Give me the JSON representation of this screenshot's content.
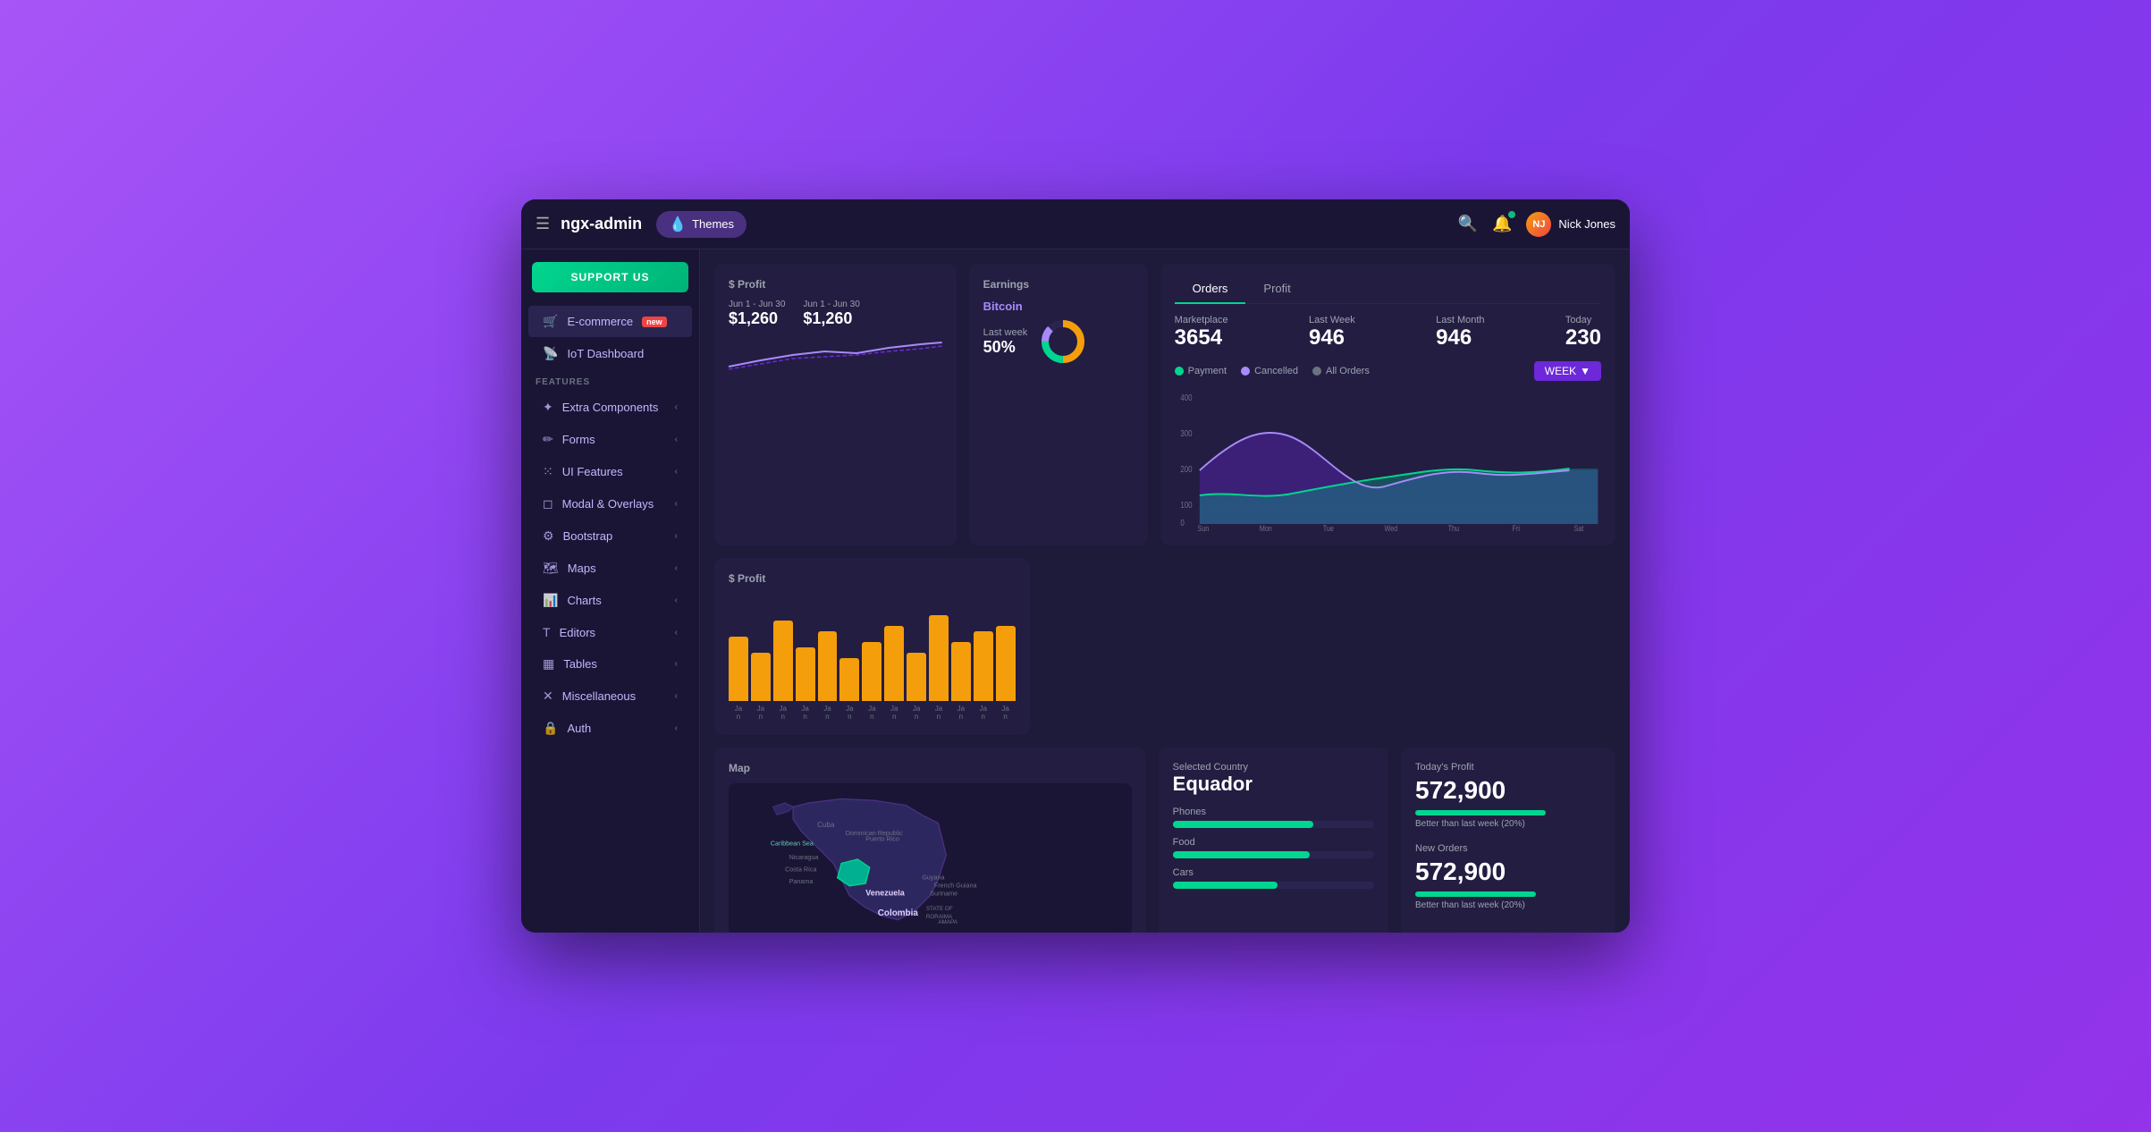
{
  "header": {
    "menu_icon": "☰",
    "logo": "ngx-admin",
    "themes_label": "Themes",
    "search_icon": "🔍",
    "user_name": "Nick Jones"
  },
  "sidebar": {
    "support_label": "SUPPORT US",
    "nav_items": [
      {
        "label": "E-commerce",
        "badge": "new",
        "icon": "🛒"
      },
      {
        "label": "IoT Dashboard",
        "icon": "📡"
      }
    ],
    "features_label": "FEATURES",
    "feature_items": [
      {
        "label": "Extra Components",
        "icon": "⭐"
      },
      {
        "label": "Forms",
        "icon": "✏️"
      },
      {
        "label": "UI Features",
        "icon": "⚙️"
      },
      {
        "label": "Modal & Overlays",
        "icon": "◻️"
      },
      {
        "label": "Bootstrap",
        "icon": "⚙️"
      },
      {
        "label": "Maps",
        "icon": "🗺️"
      },
      {
        "label": "Charts",
        "icon": "📊"
      },
      {
        "label": "Editors",
        "icon": "T"
      },
      {
        "label": "Tables",
        "icon": "▦"
      },
      {
        "label": "Miscellaneous",
        "icon": "✕"
      },
      {
        "label": "Auth",
        "icon": "🔒"
      }
    ]
  },
  "profit_card": {
    "title": "$ Profit",
    "date1": "Jun 1 - Jun 30",
    "date2": "Jun 1 - Jun 30",
    "value1": "$1,260",
    "value2": "$1,260"
  },
  "earnings_card": {
    "title": "Earnings",
    "coin": "Bitcoin",
    "week_label": "Last week",
    "week_value": "50%",
    "donut_percent": 50
  },
  "orders_card": {
    "tabs": [
      "Orders",
      "Profit"
    ],
    "active_tab": "Orders",
    "stats": [
      {
        "label": "Marketplace",
        "value": "3654"
      },
      {
        "label": "Last Week",
        "value": "946"
      },
      {
        "label": "Last Month",
        "value": "946"
      },
      {
        "label": "Today",
        "value": "230"
      }
    ],
    "legend": [
      {
        "label": "Payment",
        "color": "#00d68f"
      },
      {
        "label": "Cancelled",
        "color": "#a78bfa"
      },
      {
        "label": "All Orders",
        "color": "#6b7280"
      }
    ],
    "week_btn": "WEEK",
    "chart_yaxis": [
      "400",
      "300",
      "200",
      "100",
      "0"
    ],
    "chart_xaxis": [
      "Sun",
      "Mon",
      "Tue",
      "Wed",
      "Thu",
      "Fri",
      "Sat"
    ]
  },
  "profit_bar_card": {
    "title": "$ Profit",
    "bars": [
      60,
      45,
      75,
      50,
      65,
      40,
      55,
      70,
      45,
      80,
      55,
      65,
      70
    ],
    "bar_labels": [
      "Ja\nn",
      "Ja\nn",
      "Ja\nn",
      "Ja\nn",
      "Ja\nn",
      "Ja\nn",
      "Ja\nn",
      "Ja\nn",
      "Ja\nn",
      "Ja\nn",
      "Ja\nn",
      "Ja\nn",
      "Ja\nn"
    ]
  },
  "map_card": {
    "title": "Map"
  },
  "country_card": {
    "country_label": "Selected Country",
    "country_name": "Equador",
    "bars": [
      {
        "label": "Phones",
        "percent": 70
      },
      {
        "label": "Food",
        "percent": 68
      },
      {
        "label": "Cars",
        "percent": 52
      }
    ]
  },
  "today_profit": {
    "label": "Today's Profit",
    "value": "572,900",
    "progress": 70,
    "note": "Better than last week (20%)",
    "new_orders_label": "New Orders",
    "new_orders_value": "572,900",
    "new_orders_progress": 65,
    "new_orders_note": "Better than last week (20%)"
  }
}
